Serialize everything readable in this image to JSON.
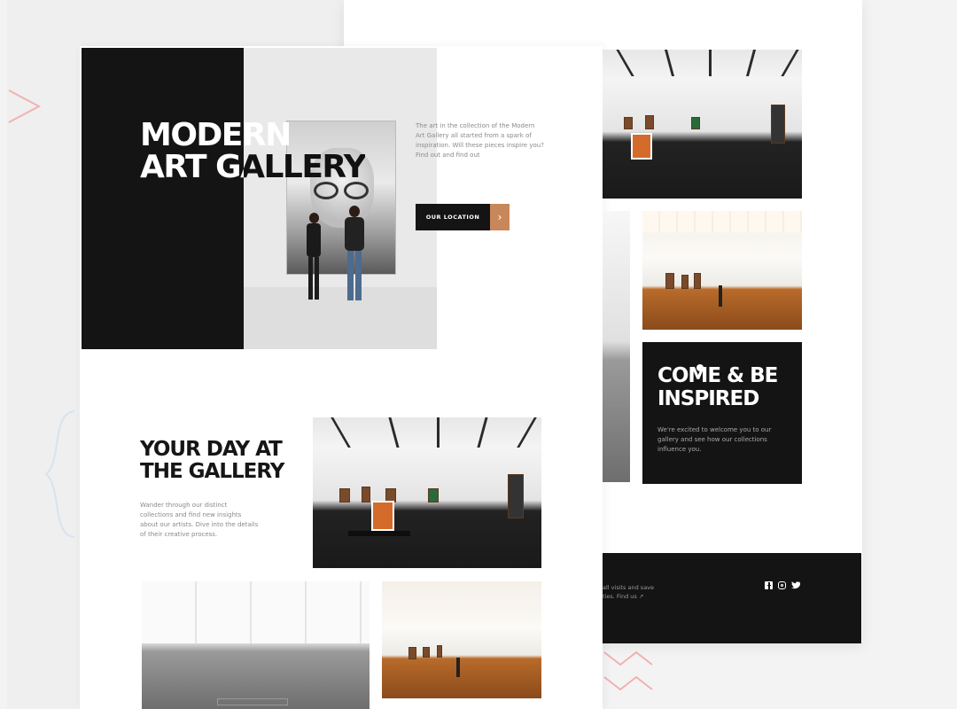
{
  "hero": {
    "title_line1": "MODERN",
    "title_line2": "ART GALLERY",
    "description": "The art in the collection of the Modern Art Gallery all started from a spark of inspiration. Will these pieces inspire you? Find out and find out",
    "cta_label": "OUR LOCATION",
    "cta_arrow": "›"
  },
  "day_section": {
    "title_line1": "YOUR DAY AT",
    "title_line2": "THE GALLERY",
    "description": "Wander through our distinct collections and find new insights about our artists. Dive into the details of their creative process."
  },
  "inspired": {
    "title_line1": "COME & BE",
    "title_line2": "INSPIRED",
    "description": "We're excited to welcome you to our gallery and see how our collections influence you."
  },
  "footer": {
    "line1": "all visits and save",
    "line2": "ties. Find us ↗",
    "social_icons": [
      "facebook-icon",
      "instagram-icon",
      "twitter-icon"
    ]
  },
  "colors": {
    "accent": "#c8875a",
    "dark": "#141414",
    "page": "#ffffff"
  }
}
